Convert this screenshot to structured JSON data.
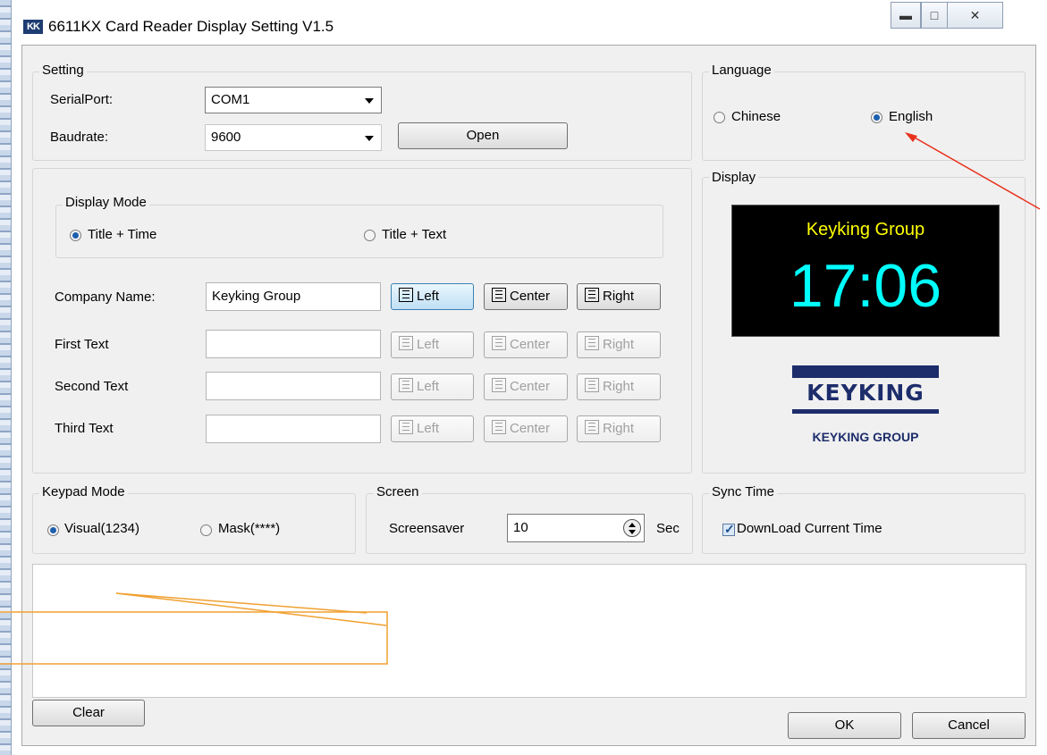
{
  "window": {
    "title": "6611KX Card Reader Display Setting V1.5",
    "icon_text": "KK",
    "controls": [
      "minimize-icon",
      "maximize-icon",
      "close-icon"
    ]
  },
  "setting": {
    "group_label": "Setting",
    "serialport_label": "SerialPort:",
    "serialport_value": "COM1",
    "baudrate_label": "Baudrate:",
    "baudrate_value": "9600",
    "open_button": "Open"
  },
  "language": {
    "group_label": "Language",
    "options": [
      "Chinese",
      "English"
    ],
    "selected": "English"
  },
  "display_mode": {
    "group_label": "Display Mode",
    "options": [
      "Title + Time",
      "Title + Text"
    ],
    "selected": "Title + Time"
  },
  "text_rows": [
    {
      "label": "Company Name:",
      "value": "Keyking Group",
      "enabled": true
    },
    {
      "label": "First Text",
      "value": "",
      "enabled": false
    },
    {
      "label": "Second Text",
      "value": "",
      "enabled": false
    },
    {
      "label": "Third Text",
      "value": "",
      "enabled": false
    }
  ],
  "align_buttons": [
    "Left",
    "Center",
    "Right"
  ],
  "preview": {
    "group_label": "Display",
    "title": "Keyking Group",
    "time": "17:06",
    "title_color": "#ffff00",
    "time_color": "#00ffff"
  },
  "logo": {
    "brand": "KEYKING",
    "sub": "KEYKING GROUP",
    "color": "#1d2d6b"
  },
  "keypad_mode": {
    "group_label": "Keypad  Mode",
    "options": [
      "Visual(1234)",
      "Mask(****)"
    ],
    "selected": "Visual(1234)"
  },
  "screen": {
    "group_label": "Screen",
    "screensaver_label": "Screensaver",
    "screensaver_value": "10",
    "unit": "Sec"
  },
  "sync_time": {
    "group_label": "Sync Time",
    "checkbox_label": "DownLoad Current Time",
    "checked": true
  },
  "footer": {
    "clear_button": "Clear",
    "ok_button": "OK",
    "cancel_button": "Cancel"
  }
}
